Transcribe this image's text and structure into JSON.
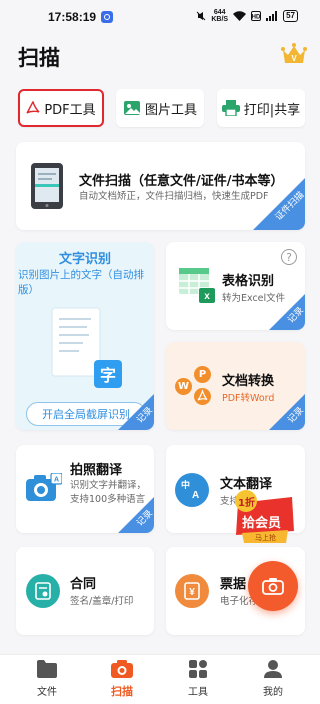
{
  "status_bar": {
    "time": "17:58:19",
    "net_speed_value": "644",
    "net_speed_unit": "KB/S",
    "battery": "57"
  },
  "header": {
    "title": "扫描"
  },
  "tools": {
    "pdf": "PDF工具",
    "image": "图片工具",
    "print": "打印|共享"
  },
  "doc_scan": {
    "title": "文件扫描（任意文件/证件/书本等）",
    "desc": "自动文档矫正，文件扫描归档，快速生成PDF",
    "ribbon": "证件扫描"
  },
  "ocr": {
    "title": "文字识别",
    "desc": "识别图片上的文字（自动排版）",
    "glyph": "字",
    "button": "开启全局截屏识别",
    "ribbon": "记录"
  },
  "table_ocr": {
    "title": "表格识别",
    "desc": "转为Excel文件",
    "help": "?",
    "ribbon": "记录"
  },
  "doc_convert": {
    "title": "文档转换",
    "desc": "PDF转Word",
    "badge_w": "W",
    "badge_p": "P",
    "ribbon": "记录"
  },
  "photo_translate": {
    "title": "拍照翻译",
    "desc": "识别文字并翻译，支持100多种语言",
    "ribbon": "记录"
  },
  "text_translate": {
    "title": "文本翻译",
    "desc": "支持",
    "icon_zh": "中",
    "icon_a": "A"
  },
  "promo": {
    "top": "1折",
    "main": "拾会员",
    "sub": "马上抢"
  },
  "contract": {
    "title": "合同",
    "desc": "签名/盖章/打印"
  },
  "receipt": {
    "title": "票据",
    "desc": "电子化存"
  },
  "nav": {
    "files": "文件",
    "scan": "扫描",
    "tools": "工具",
    "mine": "我的"
  },
  "colors": {
    "accent": "#f05a22",
    "pdf_border": "#e0282e",
    "ribbon_blue": "#4a90e2",
    "ocr_bg": "#e8f6fb",
    "convert_bg": "#fdf0e6"
  }
}
